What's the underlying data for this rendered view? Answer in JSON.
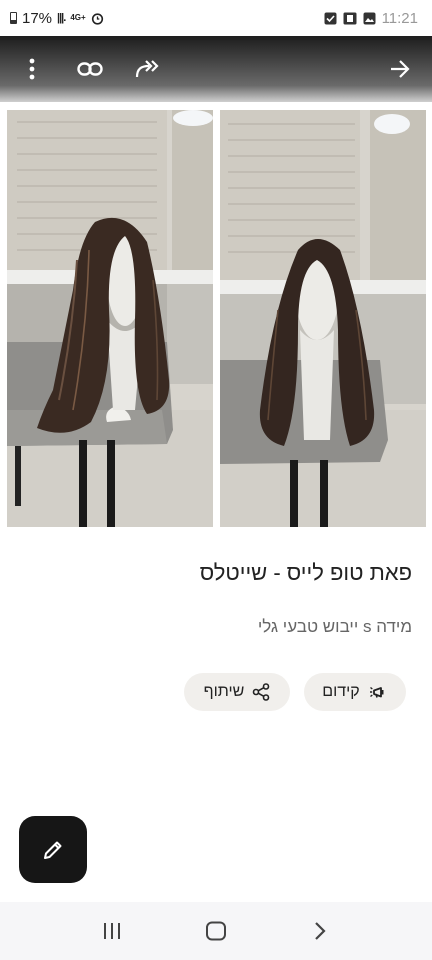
{
  "status_bar": {
    "battery": "17%",
    "network": "4G+",
    "time": "11:21"
  },
  "toolbar": {
    "icons": [
      "more-vert-icon",
      "link-icon",
      "forward-all-icon",
      "back-arrow-icon"
    ]
  },
  "listing": {
    "title": "פאת טופ לייס - שייטלס",
    "description": "מידה s ייבוש טבעי גלי",
    "promote_label": "קידום",
    "share_label": "שיתוף"
  },
  "colors": {
    "fab_bg": "#161616",
    "chip_bg": "#f1efec",
    "navbar_bg": "#f6f6f8"
  }
}
